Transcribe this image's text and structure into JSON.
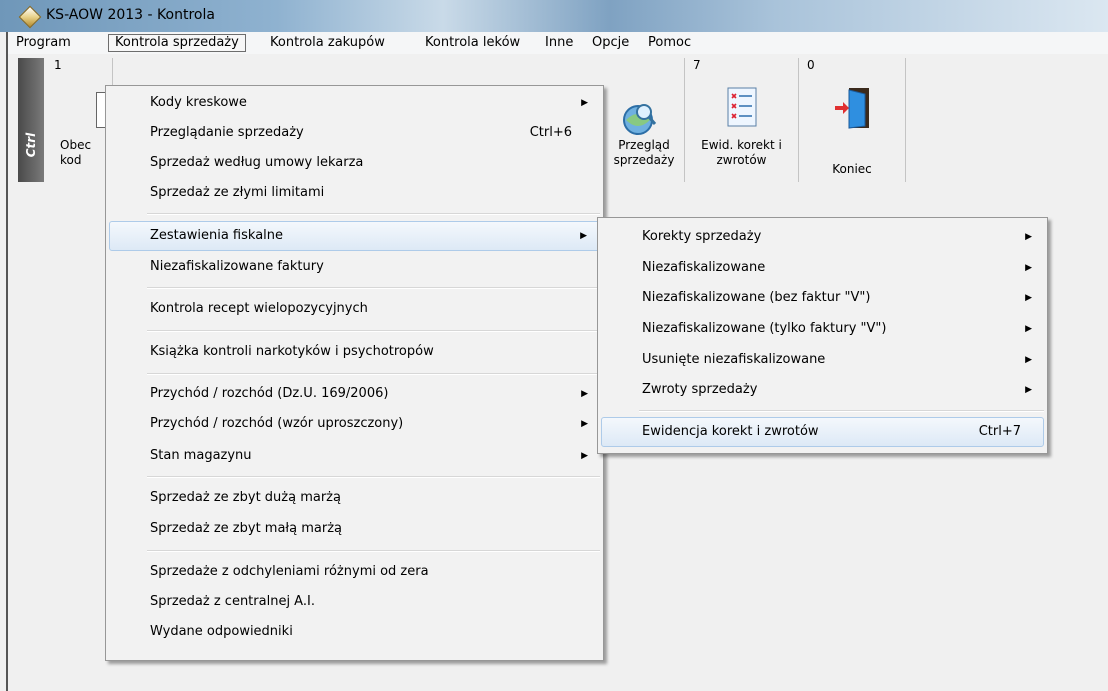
{
  "window": {
    "title": "KS-AOW 2013 - Kontrola",
    "icon": "diamond-app-icon"
  },
  "menubar": {
    "items": [
      "Program",
      "Kontrola sprzedaży",
      "Kontrola zakupów",
      "Kontrola leków",
      "Inne",
      "Opcje",
      "Pomoc"
    ],
    "active_index": 1
  },
  "toolbar": {
    "ctrl_label": "Ctrl",
    "buttons": [
      {
        "number": "1",
        "label": "Obec\nkod",
        "icon": "document-icon"
      },
      {
        "number": "",
        "label": "Przegląd\nsprzedaży",
        "icon": "magnifier-globe-icon"
      },
      {
        "number": "7",
        "label": "Ewid. korekt i\nzwrotów",
        "icon": "checklist-icon"
      },
      {
        "number": "0",
        "label": "Koniec",
        "icon": "exit-door-icon"
      }
    ]
  },
  "dropdown": {
    "items": [
      {
        "label": "Kody kreskowe",
        "shortcut": "",
        "submenu": true
      },
      {
        "label": "Przeglądanie sprzedaży",
        "shortcut": "Ctrl+6",
        "submenu": false
      },
      {
        "label": "Sprzedaż według umowy lekarza",
        "shortcut": "",
        "submenu": false
      },
      {
        "label": "Sprzedaż ze złymi limitami",
        "shortcut": "",
        "submenu": false
      },
      {
        "label": "Zestawienia fiskalne",
        "shortcut": "",
        "submenu": true,
        "highlighted": true
      },
      {
        "label": "Niezafiskalizowane faktury",
        "shortcut": "",
        "submenu": false
      },
      {
        "label": "Kontrola recept wielopozycyjnych",
        "shortcut": "",
        "submenu": false
      },
      {
        "label": "Książka kontroli narkotyków i psychotropów",
        "shortcut": "",
        "submenu": false
      },
      {
        "label": "Przychód / rozchód (Dz.U. 169/2006)",
        "shortcut": "",
        "submenu": true
      },
      {
        "label": "Przychód / rozchód (wzór uproszczony)",
        "shortcut": "",
        "submenu": true
      },
      {
        "label": "Stan magazynu",
        "shortcut": "",
        "submenu": true
      },
      {
        "label": "Sprzedaż ze zbyt dużą marżą",
        "shortcut": "",
        "submenu": false
      },
      {
        "label": "Sprzedaż ze zbyt małą marżą",
        "shortcut": "",
        "submenu": false
      },
      {
        "label": "Sprzedaże z odchyleniami różnymi od zera",
        "shortcut": "",
        "submenu": false
      },
      {
        "label": "Sprzedaż z centralnej A.I.",
        "shortcut": "",
        "submenu": false
      },
      {
        "label": "Wydane odpowiedniki",
        "shortcut": "",
        "submenu": false
      }
    ]
  },
  "submenu": {
    "items": [
      {
        "label": "Korekty sprzedaży",
        "shortcut": "",
        "submenu": true
      },
      {
        "label": "Niezafiskalizowane",
        "shortcut": "",
        "submenu": true
      },
      {
        "label": "Niezafiskalizowane (bez faktur \"V\")",
        "shortcut": "",
        "submenu": true
      },
      {
        "label": "Niezafiskalizowane (tylko faktury \"V\")",
        "shortcut": "",
        "submenu": true
      },
      {
        "label": "Usunięte niezafiskalizowane",
        "shortcut": "",
        "submenu": true
      },
      {
        "label": "Zwroty sprzedaży",
        "shortcut": "",
        "submenu": true
      },
      {
        "label": "Ewidencja korekt i zwrotów",
        "shortcut": "Ctrl+7",
        "submenu": false,
        "highlighted": true
      }
    ]
  }
}
